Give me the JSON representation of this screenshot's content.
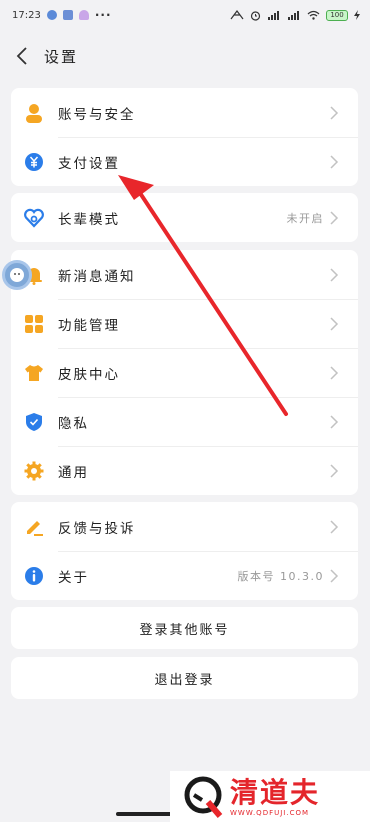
{
  "status_bar": {
    "time": "17:23",
    "dots": "···",
    "battery": "100"
  },
  "header": {
    "title": "设置"
  },
  "group1": [
    {
      "label": "账号与安全",
      "icon": "user-icon"
    },
    {
      "label": "支付设置",
      "icon": "yuan-icon"
    }
  ],
  "group2": [
    {
      "label": "长辈模式",
      "icon": "heart-icon",
      "value": "未开启"
    }
  ],
  "group3": [
    {
      "label": "新消息通知",
      "icon": "bell-icon"
    },
    {
      "label": "功能管理",
      "icon": "grid-icon"
    },
    {
      "label": "皮肤中心",
      "icon": "shirt-icon"
    },
    {
      "label": "隐私",
      "icon": "shield-icon"
    },
    {
      "label": "通用",
      "icon": "gear-icon"
    }
  ],
  "group4": [
    {
      "label": "反馈与投诉",
      "icon": "pencil-icon"
    },
    {
      "label": "关于",
      "icon": "info-icon",
      "value": "版本号 10.3.0"
    }
  ],
  "buttons": {
    "switch_account": "登录其他账号",
    "logout": "退出登录"
  },
  "watermark": {
    "title": "清道夫",
    "url": "WWW.QDFUJI.COM"
  },
  "colors": {
    "accent_orange": "#f5a623",
    "accent_blue": "#2b7de9",
    "arrow_red": "#e8262b"
  }
}
